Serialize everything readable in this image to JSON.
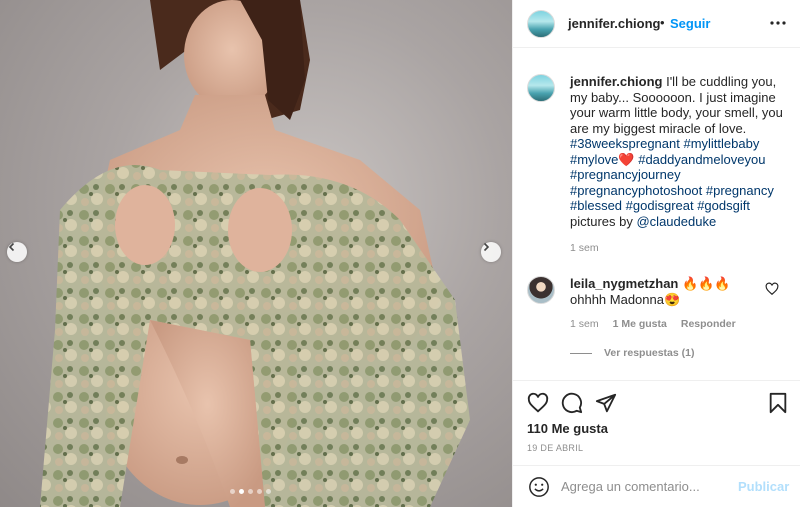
{
  "post": {
    "image_alt": "",
    "carousel": {
      "count": 5,
      "active_index": 1
    }
  },
  "header": {
    "username": "jennifer.chiong",
    "separator": "•",
    "follow_label": "Seguir"
  },
  "caption": {
    "username": "jennifer.chiong",
    "text_1": " I'll be cuddling you, my baby... Soooooon. I just imagine your warm little body, your smell, you are my biggest miracle of love. ",
    "tags_1": "#38weekspregnant #mylittlebaby #mylove",
    "heart": "❤️",
    "tags_2": " #daddyandmeloveyou #pregnancyjourney #pregnancyphotoshoot #pregnancy #blessed #godisgreat #godsgift",
    "text_2": " pictures by ",
    "mention": "@claudeduke",
    "time": "1 sem"
  },
  "comment": {
    "username": "leila_nygmetzhan",
    "flames": " 🔥🔥🔥",
    "text": "ohhhh Madonna😍",
    "time": "1 sem",
    "likes": "1 Me gusta",
    "reply_label": "Responder",
    "view_replies": "Ver respuestas (1)"
  },
  "actions": {
    "likes_label": "110 Me gusta",
    "date": "19 DE ABRIL"
  },
  "add_comment": {
    "placeholder": "Agrega un comentario...",
    "post_label": "Publicar"
  },
  "colors": {
    "accent": "#0095f6",
    "post_disabled": "#b2dffc",
    "secondary_text": "#8e8e8e",
    "hashtag": "#00376b"
  }
}
